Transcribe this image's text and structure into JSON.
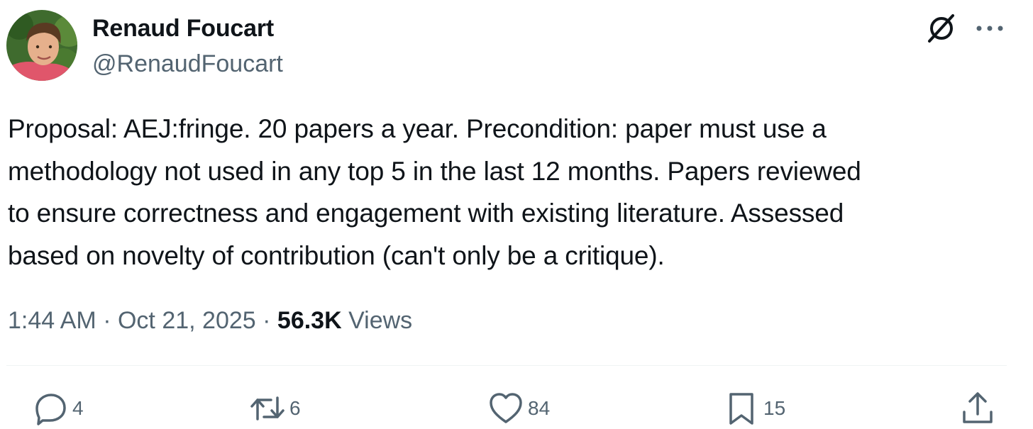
{
  "author": {
    "display_name": "Renaud Foucart",
    "handle": "@RenaudFoucart"
  },
  "tweet": {
    "text": "Proposal: AEJ:fringe. 20 papers a year. Precondition: paper must use a\nmethodology not used in any top 5 in the last 12 months. Papers reviewed\nto ensure correctness and engagement with existing literature. Assessed\nbased on novelty of contribution (can't only be a critique)."
  },
  "meta": {
    "time": "1:44 AM",
    "separator": "·",
    "date": "Oct 21, 2025",
    "views_count": "56.3K",
    "views_label": "Views"
  },
  "actions": {
    "replies": "4",
    "reposts": "6",
    "likes": "84",
    "bookmarks": "15"
  },
  "icons": [
    "grok-icon",
    "more-icon",
    "reply-icon",
    "retweet-icon",
    "like-icon",
    "bookmark-icon",
    "share-icon"
  ],
  "colors": {
    "text": "#0f1419",
    "secondary": "#536471",
    "divider": "#eff3f4"
  }
}
